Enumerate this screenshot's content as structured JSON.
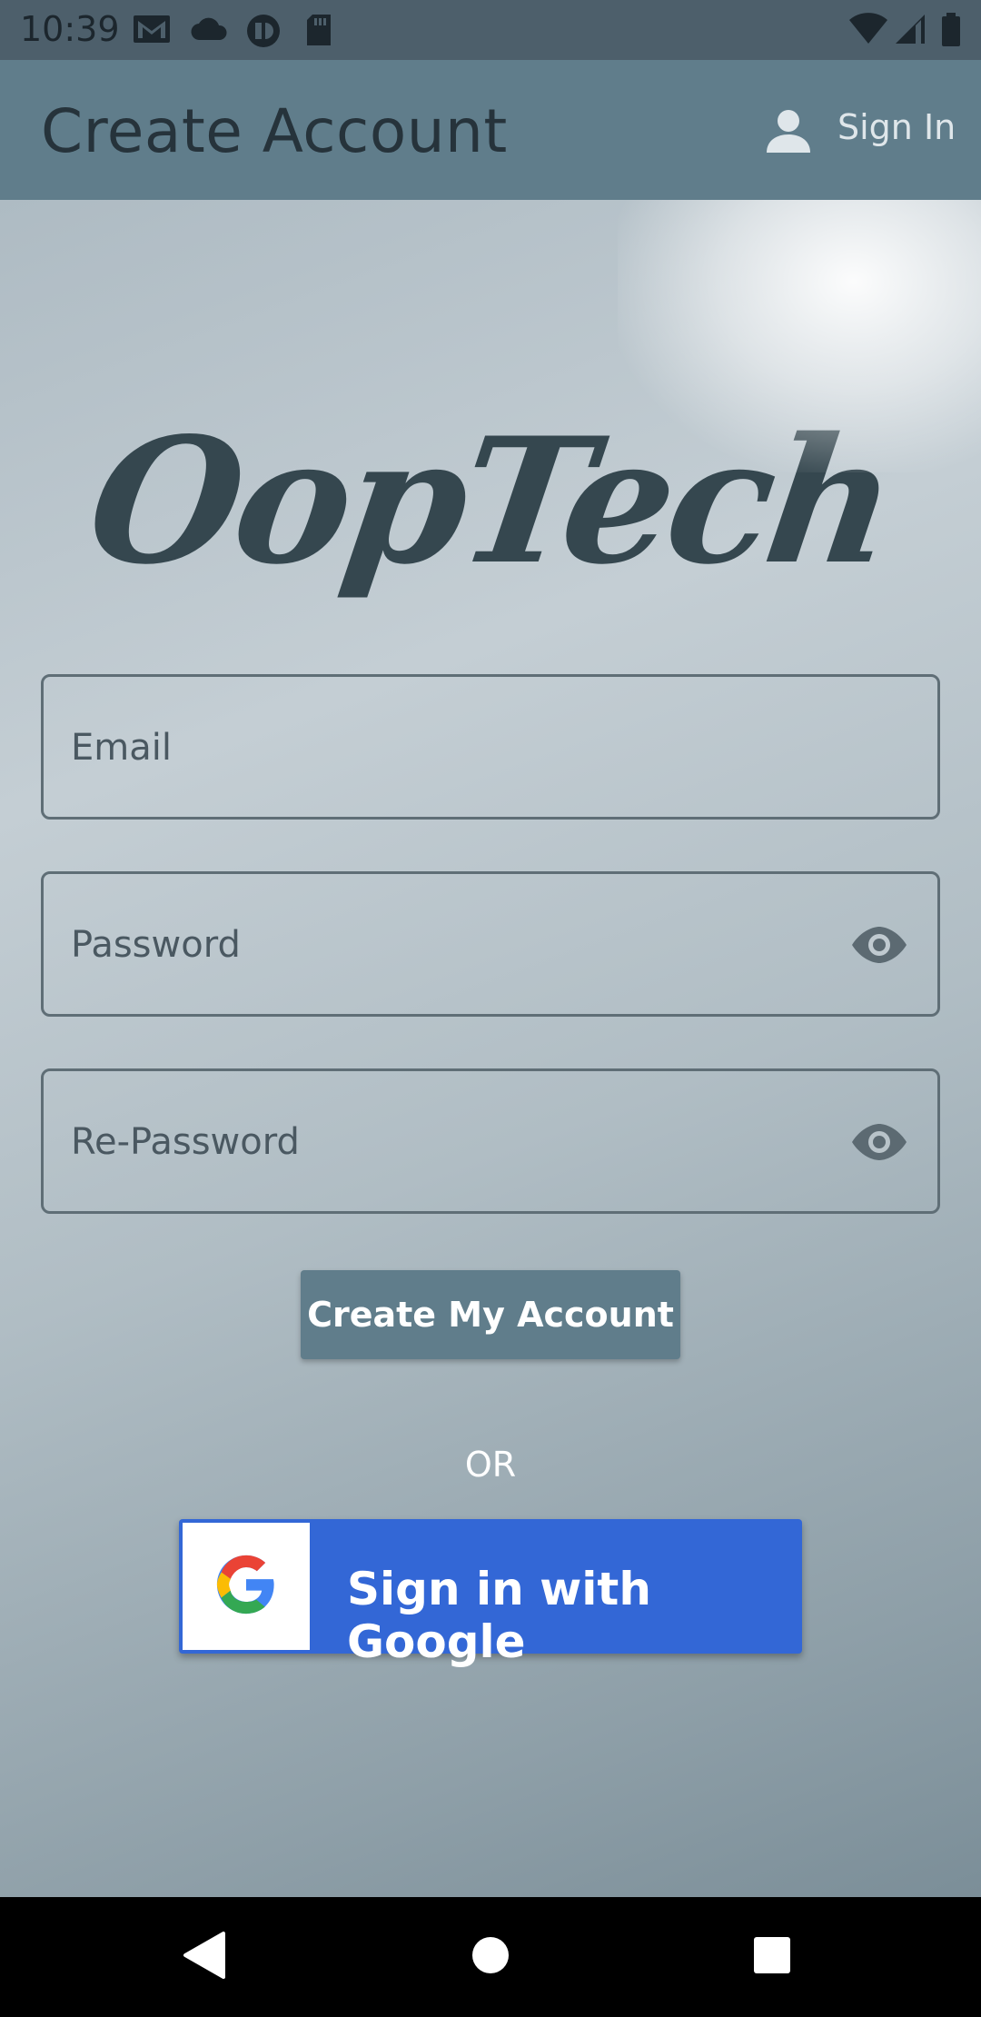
{
  "status_bar": {
    "time": "10:39",
    "left_icons": [
      "gmail-icon",
      "cloud-icon",
      "app-icon",
      "sd-card-icon"
    ],
    "right_icons": [
      "wifi-icon",
      "signal-icon",
      "battery-icon"
    ]
  },
  "app_bar": {
    "title": "Create Account",
    "sign_in_label": "Sign In"
  },
  "logo": {
    "text": "OopTech"
  },
  "form": {
    "email_placeholder": "Email",
    "password_placeholder": "Password",
    "repassword_placeholder": "Re-Password",
    "submit_label": "Create My Account"
  },
  "divider_text": "OR",
  "google": {
    "label": "Sign in with Google",
    "brand_color": "#3367d6"
  },
  "colors": {
    "primary": "#607d8b",
    "status_bar": "#4d5f6b",
    "logo_text": "#35474f"
  },
  "nav_bar": {
    "buttons": [
      "back-icon",
      "home-icon",
      "recents-icon"
    ]
  }
}
